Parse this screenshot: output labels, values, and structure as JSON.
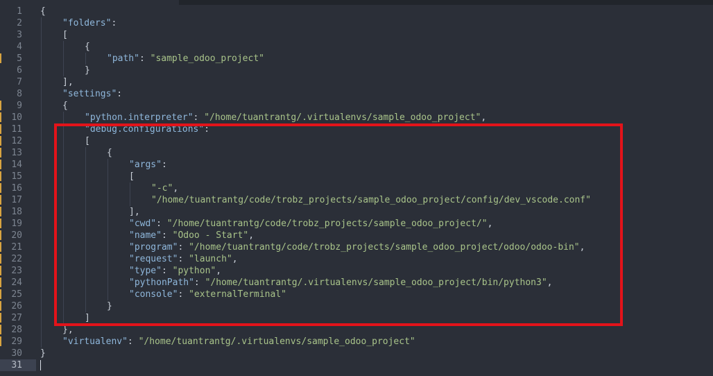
{
  "editor": {
    "tab_strip": "",
    "current_line": 31,
    "annotation": "highlight-box around debug.configurations block"
  },
  "lines": [
    {
      "num": "1",
      "modified": false,
      "indent": 0,
      "tokens": [
        {
          "t": "pun",
          "v": "{"
        }
      ]
    },
    {
      "num": "2",
      "modified": false,
      "indent": 1,
      "tokens": [
        {
          "t": "key",
          "v": "\"folders\""
        },
        {
          "t": "pun",
          "v": ":"
        }
      ]
    },
    {
      "num": "3",
      "modified": false,
      "indent": 1,
      "tokens": [
        {
          "t": "pun",
          "v": "["
        }
      ]
    },
    {
      "num": "4",
      "modified": false,
      "indent": 2,
      "tokens": [
        {
          "t": "pun",
          "v": "{"
        }
      ]
    },
    {
      "num": "5",
      "modified": true,
      "indent": 3,
      "tokens": [
        {
          "t": "key",
          "v": "\"path\""
        },
        {
          "t": "pun",
          "v": ": "
        },
        {
          "t": "str",
          "v": "\"sample_odoo_project\""
        }
      ]
    },
    {
      "num": "6",
      "modified": false,
      "indent": 2,
      "tokens": [
        {
          "t": "pun",
          "v": "}"
        }
      ]
    },
    {
      "num": "7",
      "modified": false,
      "indent": 1,
      "tokens": [
        {
          "t": "pun",
          "v": "],"
        }
      ]
    },
    {
      "num": "8",
      "modified": false,
      "indent": 1,
      "tokens": [
        {
          "t": "key",
          "v": "\"settings\""
        },
        {
          "t": "pun",
          "v": ":"
        }
      ]
    },
    {
      "num": "9",
      "modified": true,
      "indent": 1,
      "tokens": [
        {
          "t": "pun",
          "v": "{"
        }
      ]
    },
    {
      "num": "10",
      "modified": true,
      "indent": 2,
      "tokens": [
        {
          "t": "key",
          "v": "\"python.interpreter\""
        },
        {
          "t": "pun",
          "v": ": "
        },
        {
          "t": "str",
          "v": "\"/home/tuantrantg/.virtualenvs/sample_odoo_project\""
        },
        {
          "t": "pun",
          "v": ","
        }
      ]
    },
    {
      "num": "11",
      "modified": true,
      "indent": 2,
      "tokens": [
        {
          "t": "key",
          "v": "\"debug.configurations\""
        },
        {
          "t": "pun",
          "v": ":"
        }
      ]
    },
    {
      "num": "12",
      "modified": true,
      "indent": 2,
      "tokens": [
        {
          "t": "pun",
          "v": "["
        }
      ]
    },
    {
      "num": "13",
      "modified": true,
      "indent": 3,
      "tokens": [
        {
          "t": "pun",
          "v": "{"
        }
      ]
    },
    {
      "num": "14",
      "modified": true,
      "indent": 4,
      "tokens": [
        {
          "t": "key",
          "v": "\"args\""
        },
        {
          "t": "pun",
          "v": ":"
        }
      ]
    },
    {
      "num": "15",
      "modified": true,
      "indent": 4,
      "tokens": [
        {
          "t": "pun",
          "v": "["
        }
      ]
    },
    {
      "num": "16",
      "modified": true,
      "indent": 5,
      "tokens": [
        {
          "t": "str",
          "v": "\"-c\""
        },
        {
          "t": "pun",
          "v": ","
        }
      ]
    },
    {
      "num": "17",
      "modified": true,
      "indent": 5,
      "tokens": [
        {
          "t": "str",
          "v": "\"/home/tuantrantg/code/trobz_projects/sample_odoo_project/config/dev_vscode.conf\""
        }
      ]
    },
    {
      "num": "18",
      "modified": true,
      "indent": 4,
      "tokens": [
        {
          "t": "pun",
          "v": "],"
        }
      ]
    },
    {
      "num": "19",
      "modified": true,
      "indent": 4,
      "tokens": [
        {
          "t": "key",
          "v": "\"cwd\""
        },
        {
          "t": "pun",
          "v": ": "
        },
        {
          "t": "str",
          "v": "\"/home/tuantrantg/code/trobz_projects/sample_odoo_project/\""
        },
        {
          "t": "pun",
          "v": ","
        }
      ]
    },
    {
      "num": "20",
      "modified": true,
      "indent": 4,
      "tokens": [
        {
          "t": "key",
          "v": "\"name\""
        },
        {
          "t": "pun",
          "v": ": "
        },
        {
          "t": "str",
          "v": "\"Odoo - Start\""
        },
        {
          "t": "pun",
          "v": ","
        }
      ]
    },
    {
      "num": "21",
      "modified": true,
      "indent": 4,
      "tokens": [
        {
          "t": "key",
          "v": "\"program\""
        },
        {
          "t": "pun",
          "v": ": "
        },
        {
          "t": "str",
          "v": "\"/home/tuantrantg/code/trobz_projects/sample_odoo_project/odoo/odoo-bin\""
        },
        {
          "t": "pun",
          "v": ","
        }
      ]
    },
    {
      "num": "22",
      "modified": true,
      "indent": 4,
      "tokens": [
        {
          "t": "key",
          "v": "\"request\""
        },
        {
          "t": "pun",
          "v": ": "
        },
        {
          "t": "str",
          "v": "\"launch\""
        },
        {
          "t": "pun",
          "v": ","
        }
      ]
    },
    {
      "num": "23",
      "modified": true,
      "indent": 4,
      "tokens": [
        {
          "t": "key",
          "v": "\"type\""
        },
        {
          "t": "pun",
          "v": ": "
        },
        {
          "t": "str",
          "v": "\"python\""
        },
        {
          "t": "pun",
          "v": ","
        }
      ]
    },
    {
      "num": "24",
      "modified": true,
      "indent": 4,
      "tokens": [
        {
          "t": "key",
          "v": "\"pythonPath\""
        },
        {
          "t": "pun",
          "v": ": "
        },
        {
          "t": "str",
          "v": "\"/home/tuantrantg/.virtualenvs/sample_odoo_project/bin/python3\""
        },
        {
          "t": "pun",
          "v": ","
        }
      ]
    },
    {
      "num": "25",
      "modified": true,
      "indent": 4,
      "tokens": [
        {
          "t": "key",
          "v": "\"console\""
        },
        {
          "t": "pun",
          "v": ": "
        },
        {
          "t": "str",
          "v": "\"externalTerminal\""
        }
      ]
    },
    {
      "num": "26",
      "modified": true,
      "indent": 3,
      "tokens": [
        {
          "t": "pun",
          "v": "}"
        }
      ]
    },
    {
      "num": "27",
      "modified": true,
      "indent": 2,
      "tokens": [
        {
          "t": "pun",
          "v": "]"
        }
      ]
    },
    {
      "num": "28",
      "modified": true,
      "indent": 1,
      "tokens": [
        {
          "t": "pun",
          "v": "},"
        }
      ]
    },
    {
      "num": "29",
      "modified": true,
      "indent": 1,
      "tokens": [
        {
          "t": "key",
          "v": "\"virtualenv\""
        },
        {
          "t": "pun",
          "v": ": "
        },
        {
          "t": "str",
          "v": "\"/home/tuantrantg/.virtualenvs/sample_odoo_project\""
        }
      ]
    },
    {
      "num": "30",
      "modified": false,
      "indent": 0,
      "tokens": [
        {
          "t": "pun",
          "v": "}"
        }
      ]
    },
    {
      "num": "31",
      "modified": false,
      "indent": 0,
      "tokens": []
    }
  ],
  "colors": {
    "background": "#2b2f38",
    "key": "#8fb7db",
    "string": "#a9c48a",
    "line_number": "#7d8591",
    "modified_marker": "#d8a441",
    "highlight_border": "#e3131a"
  }
}
